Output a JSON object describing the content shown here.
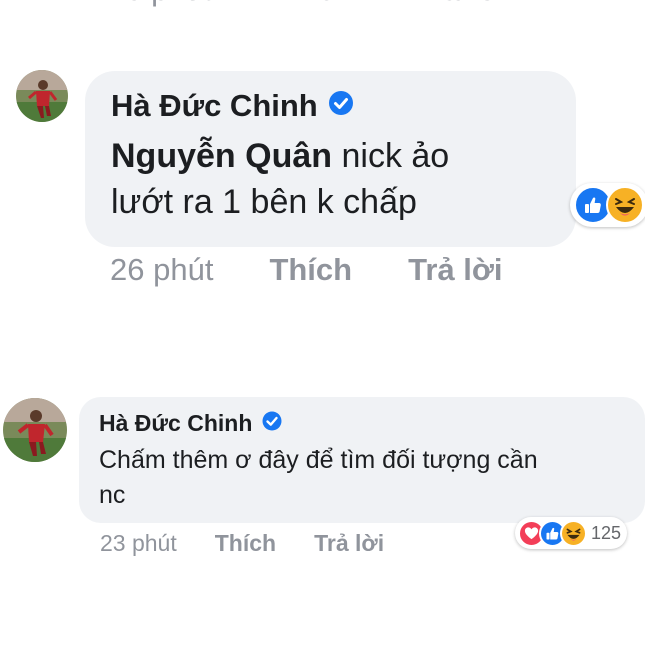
{
  "cut_row": {
    "time": "26 phút",
    "like_label": "Thích",
    "reply_label": "Trả lời"
  },
  "comments": [
    {
      "author": "Hà Đức Chinh",
      "mention": "Nguyễn Quân",
      "text_line1": " nick ảo",
      "text_line2": "lướt ra 1 bên k chấp",
      "time": "26 phút",
      "like_label": "Thích",
      "reply_label": "Trả lời",
      "reactions": [
        "like-icon",
        "haha-icon"
      ]
    },
    {
      "author": "Hà Đức Chinh",
      "text_line1": "Chấm thêm ơ đây để tìm đối tượng cần",
      "text_line2": "nc",
      "time": "23 phút",
      "like_label": "Thích",
      "reply_label": "Trả lời",
      "reactions": [
        "love-icon",
        "like-icon",
        "haha-icon"
      ],
      "reaction_count": "125"
    }
  ],
  "colors": {
    "bubble": "#f0f2f5",
    "meta_text": "#90949c",
    "verified": "#1877f2",
    "like": "#1877f2",
    "love": "#f33e58",
    "haha": "#f7b125"
  }
}
